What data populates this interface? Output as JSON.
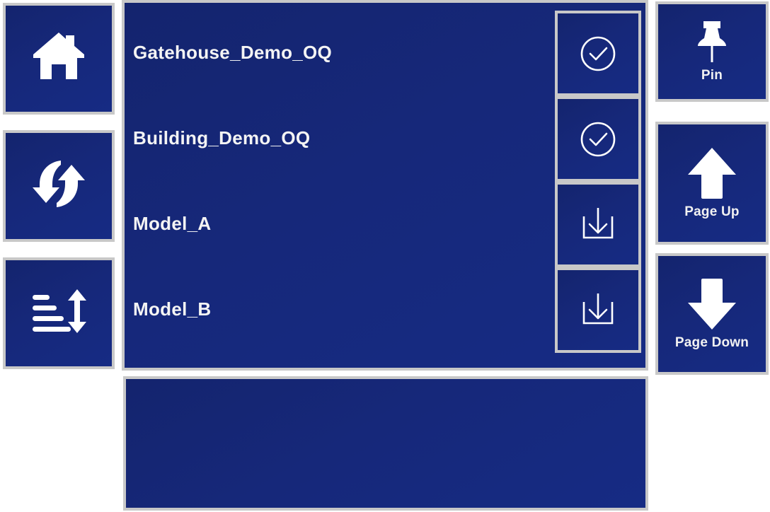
{
  "left_rail": {
    "buttons": [
      {
        "name": "home",
        "icon": "home-icon",
        "label": ""
      },
      {
        "name": "refresh",
        "icon": "refresh-sync-icon",
        "label": ""
      },
      {
        "name": "sort",
        "icon": "sort-lines-vertical-arrow-icon",
        "label": ""
      }
    ]
  },
  "list": {
    "rows": [
      {
        "label": "Gatehouse_Demo_OQ",
        "action_icon": "check-circle-icon",
        "action_state": "loaded"
      },
      {
        "label": "Building_Demo_OQ",
        "action_icon": "check-circle-icon",
        "action_state": "loaded"
      },
      {
        "label": "Model_A",
        "action_icon": "download-icon",
        "action_state": "not-loaded"
      },
      {
        "label": "Model_B",
        "action_icon": "download-icon",
        "action_state": "not-loaded"
      }
    ]
  },
  "bottom_panel": {
    "content": ""
  },
  "right_rail": {
    "buttons": [
      {
        "name": "pin",
        "icon": "pushpin-icon",
        "label": "Pin"
      },
      {
        "name": "page-up",
        "icon": "arrow-up-icon",
        "label": "Page Up"
      },
      {
        "name": "page-down",
        "icon": "arrow-down-icon",
        "label": "Page Down"
      }
    ]
  },
  "colors": {
    "panel_blue_dark": "#14246e",
    "panel_blue_light": "#162b84",
    "border_grey": "#c8c8c8",
    "text_white": "#f4f4f4",
    "page_background": "#ffffff"
  }
}
